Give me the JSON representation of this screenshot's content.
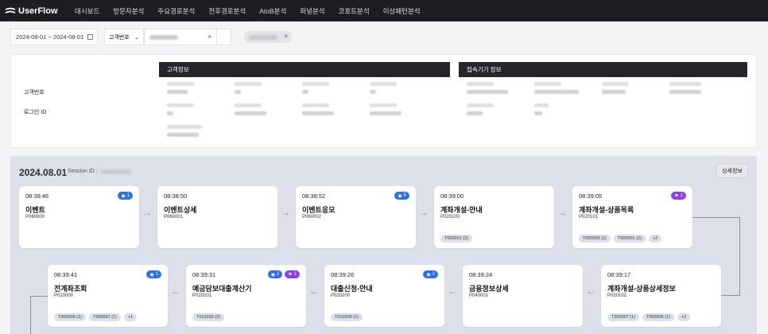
{
  "app": {
    "name": "UserFlow"
  },
  "nav": [
    "대시보드",
    "방문자분석",
    "주요경로분석",
    "전후경로분석",
    "AtoB분석",
    "퍼널분석",
    "코호트분석",
    "이상패턴분석"
  ],
  "filters": {
    "date_range": "2024-08-01 ~ 2024-08-01",
    "select_label": "고객번호",
    "clear_icon": "×"
  },
  "info": {
    "labels": {
      "customer_no": "고객번호",
      "login_id": "로그인 ID"
    },
    "customer_card_title": "고객정보",
    "device_card_title": "접속기기 정보"
  },
  "journey": {
    "date": "2024.08.01",
    "session_label": "Session ID :",
    "detail_button": "상세정보",
    "steps": [
      {
        "time": "08:38:46",
        "name": "이벤트",
        "code": "P060000",
        "views": "1",
        "flags": null,
        "tags": []
      },
      {
        "time": "08:38:50",
        "name": "이벤트상세",
        "code": "P060001",
        "views": null,
        "flags": null,
        "tags": []
      },
      {
        "time": "08:38:52",
        "name": "이벤트응모",
        "code": "P060002",
        "views": "5",
        "flags": null,
        "tags": []
      },
      {
        "time": "08:39:00",
        "name": "계좌개설-안내",
        "code": "P020100",
        "views": null,
        "flags": null,
        "tags": [
          "T000001 (2)"
        ]
      },
      {
        "time": "08:39:05",
        "name": "계좌개설-상품목록",
        "code": "P020101",
        "views": null,
        "flags": "1",
        "tags": [
          "T000003 (1)",
          "T000001 (2)",
          "+2"
        ]
      },
      {
        "time": "08:39:17",
        "name": "계좌개설-상품상세정보",
        "code": "P020102",
        "views": null,
        "flags": null,
        "tags": [
          "T000007 (1)",
          "T000005 (1)",
          "+2"
        ]
      },
      {
        "time": "08:39:24",
        "name": "금융정보상세",
        "code": "P040001",
        "views": null,
        "flags": null,
        "tags": []
      },
      {
        "time": "08:39:26",
        "name": "대출신청-안내",
        "code": "P020200",
        "views": "2",
        "flags": null,
        "tags": [
          "T010200 (1)"
        ]
      },
      {
        "time": "08:39:31",
        "name": "예금담보대출계산기",
        "code": "P020201",
        "views": "2",
        "flags": "1",
        "tags": [
          "T010200 (2)"
        ]
      },
      {
        "time": "08:39:41",
        "name": "전계좌조회",
        "code": "P010000",
        "views": "1",
        "flags": null,
        "tags": [
          "T000009 (1)",
          "T000007 (1)",
          "+1"
        ]
      }
    ]
  },
  "colors": {
    "nav_bg": "#1d1e22",
    "view_badge": "#2f6fe0",
    "flag_badge": "#8e3fe3",
    "journey_bg": "#dde0ea"
  },
  "icons": {
    "logo": "swoosh-logo-icon",
    "view": "eye-icon",
    "flag": "flag-icon",
    "arrow": "arrow-right-icon",
    "calendar": "calendar-icon"
  }
}
